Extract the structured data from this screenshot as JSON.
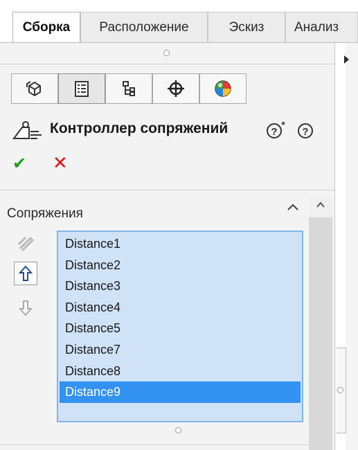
{
  "tabs": [
    {
      "label": "Сборка",
      "active": true
    },
    {
      "label": "Расположение",
      "active": false
    },
    {
      "label": "Эскиз",
      "active": false
    },
    {
      "label": "Анализ",
      "active": false
    }
  ],
  "feature_tabs": [
    {
      "icon": "featuremanager-tree-icon",
      "active": false
    },
    {
      "icon": "property-manager-icon",
      "active": true
    },
    {
      "icon": "configuration-manager-icon",
      "active": false
    },
    {
      "icon": "dimxpert-manager-icon",
      "active": false
    },
    {
      "icon": "display-manager-icon",
      "active": false
    }
  ],
  "property_manager": {
    "title": "Контроллер сопряжений",
    "help_icons": [
      "whats-new-help-icon",
      "help-icon"
    ],
    "ok_symbol": "✔",
    "cancel_symbol": "✕"
  },
  "mates_group": {
    "title": "Сопряжения",
    "items": [
      "Distance1",
      "Distance2",
      "Distance3",
      "Distance4",
      "Distance5",
      "Distance7",
      "Distance8",
      "Distance9"
    ],
    "selected_index": 7
  },
  "colors": {
    "selection": "#3391f2",
    "list_background": "#cfe2f6",
    "ok": "#1aa01a",
    "cancel": "#e01010"
  }
}
